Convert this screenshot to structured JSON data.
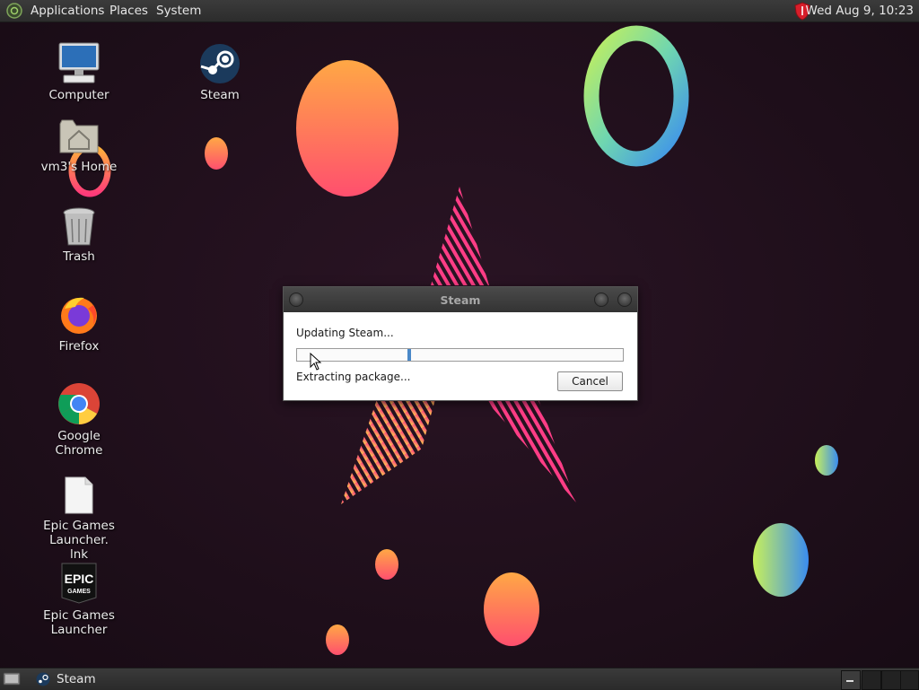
{
  "top_panel": {
    "applications": "Applications",
    "places": "Places",
    "system": "System",
    "clock": "Wed Aug  9, 10:23"
  },
  "desktop": {
    "icons": [
      {
        "label": "Computer",
        "icon": "computer-icon"
      },
      {
        "label": "vm3's Home",
        "icon": "home-folder-icon"
      },
      {
        "label": "Trash",
        "icon": "trash-icon"
      },
      {
        "label": "Firefox",
        "icon": "firefox-icon"
      },
      {
        "label": "Google Chrome",
        "icon": "chrome-icon"
      },
      {
        "label": "Epic Games Launcher.\nlnk",
        "icon": "file-icon"
      },
      {
        "label": "Epic Games Launcher",
        "icon": "epic-games-icon",
        "logo_text": "EPIC GAMES"
      },
      {
        "label": "Steam",
        "icon": "steam-icon"
      }
    ]
  },
  "dialog": {
    "title": "Steam",
    "status": "Updating Steam...",
    "progress": 0.35,
    "substatus": "Extracting package...",
    "cancel_label": "Cancel"
  },
  "taskbar": {
    "tasks": [
      {
        "label": "Steam",
        "icon": "steam-icon"
      }
    ],
    "workspaces": 4
  },
  "colors": {
    "panel": "#2f2f2f",
    "wallpaper": "#1e1019",
    "progress_accent": "#4a88c8",
    "dialog_bg": "#ffffff"
  }
}
